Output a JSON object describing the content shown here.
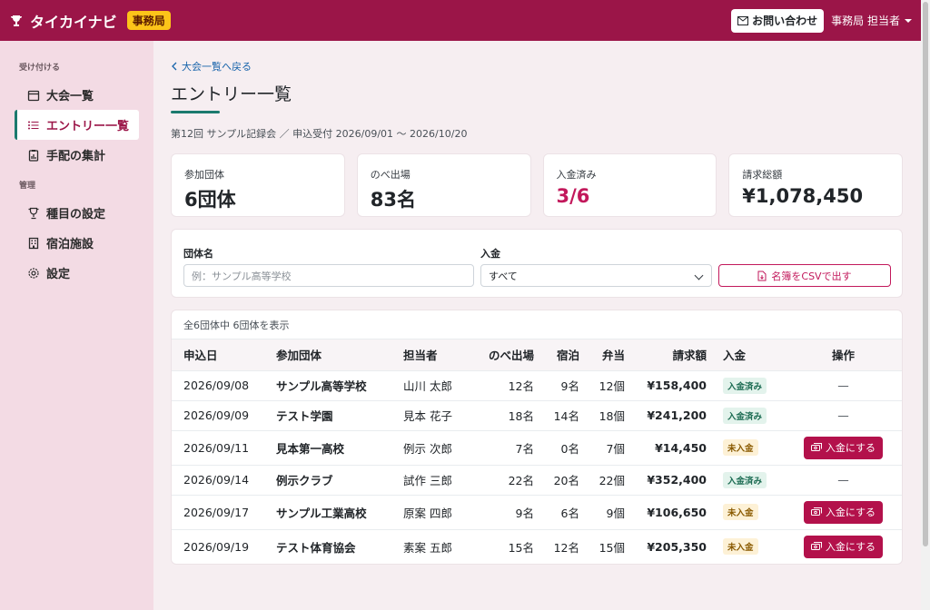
{
  "header": {
    "app_name": "タイカイナビ",
    "role_badge": "事務局",
    "contact_label": "お問い合わせ",
    "user_label": "事務局 担当者"
  },
  "sidebar": {
    "section_accept": "受け付ける",
    "section_manage": "管理",
    "items": [
      {
        "label": "大会一覧",
        "icon": "calendar-icon"
      },
      {
        "label": "エントリー一覧",
        "icon": "list-icon",
        "active": true
      },
      {
        "label": "手配の集計",
        "icon": "clipboard-chart-icon"
      },
      {
        "label": "種目の設定",
        "icon": "trophy-icon"
      },
      {
        "label": "宿泊施設",
        "icon": "building-icon"
      },
      {
        "label": "設定",
        "icon": "gear-icon"
      }
    ]
  },
  "main": {
    "back_link": "大会一覧へ戻る",
    "title": "エントリー一覧",
    "event_meta": "第12回 サンプル記録会 ／ 申込受付 2026/09/01 〜 2026/10/20",
    "stats": [
      {
        "label": "参加団体",
        "value": "6団体"
      },
      {
        "label": "のべ出場",
        "value": "83名"
      },
      {
        "label": "入金済み",
        "value": "3/6"
      },
      {
        "label": "請求総額",
        "value": "¥1,078,450"
      }
    ],
    "filter": {
      "team_label": "団体名",
      "team_placeholder": "例：サンプル高等学校",
      "payment_label": "入金",
      "payment_value": "すべて",
      "csv_button": "名簿をCSVで出す"
    },
    "table": {
      "caption": "全6団体中 6団体を表示",
      "headers": {
        "date": "申込日",
        "team": "参加団体",
        "person": "担当者",
        "entries": "のべ出場",
        "stay": "宿泊",
        "lunch": "弁当",
        "amount": "請求額",
        "paid": "入金",
        "action": "操作"
      },
      "pay_button": "入金にする",
      "dash": "—",
      "rows": [
        {
          "date": "2026/09/08",
          "team": "サンプル高等学校",
          "person": "山川 太郎",
          "entries": "12名",
          "stay": "9名",
          "lunch": "12個",
          "amount": "¥158,400",
          "paid": "入金済み"
        },
        {
          "date": "2026/09/09",
          "team": "テスト学園",
          "person": "見本 花子",
          "entries": "18名",
          "stay": "14名",
          "lunch": "18個",
          "amount": "¥241,200",
          "paid": "入金済み"
        },
        {
          "date": "2026/09/11",
          "team": "見本第一高校",
          "person": "例示 次郎",
          "entries": "7名",
          "stay": "0名",
          "lunch": "7個",
          "amount": "¥14,450",
          "paid": "未入金"
        },
        {
          "date": "2026/09/14",
          "team": "例示クラブ",
          "person": "試作 三郎",
          "entries": "22名",
          "stay": "20名",
          "lunch": "22個",
          "amount": "¥352,400",
          "paid": "入金済み"
        },
        {
          "date": "2026/09/17",
          "team": "サンプル工業高校",
          "person": "原案 四郎",
          "entries": "9名",
          "stay": "6名",
          "lunch": "9個",
          "amount": "¥106,650",
          "paid": "未入金"
        },
        {
          "date": "2026/09/19",
          "team": "テスト体育協会",
          "person": "素案 五郎",
          "entries": "15名",
          "stay": "12名",
          "lunch": "15個",
          "amount": "¥205,350",
          "paid": "未入金"
        }
      ]
    }
  },
  "colors": {
    "brand": "#9b1548",
    "accent_teal": "#1b7a6e",
    "sidebar_bg": "#f3dbe4",
    "paid_bg": "#e3f3ec",
    "unpaid_bg": "#fdf1d6"
  }
}
